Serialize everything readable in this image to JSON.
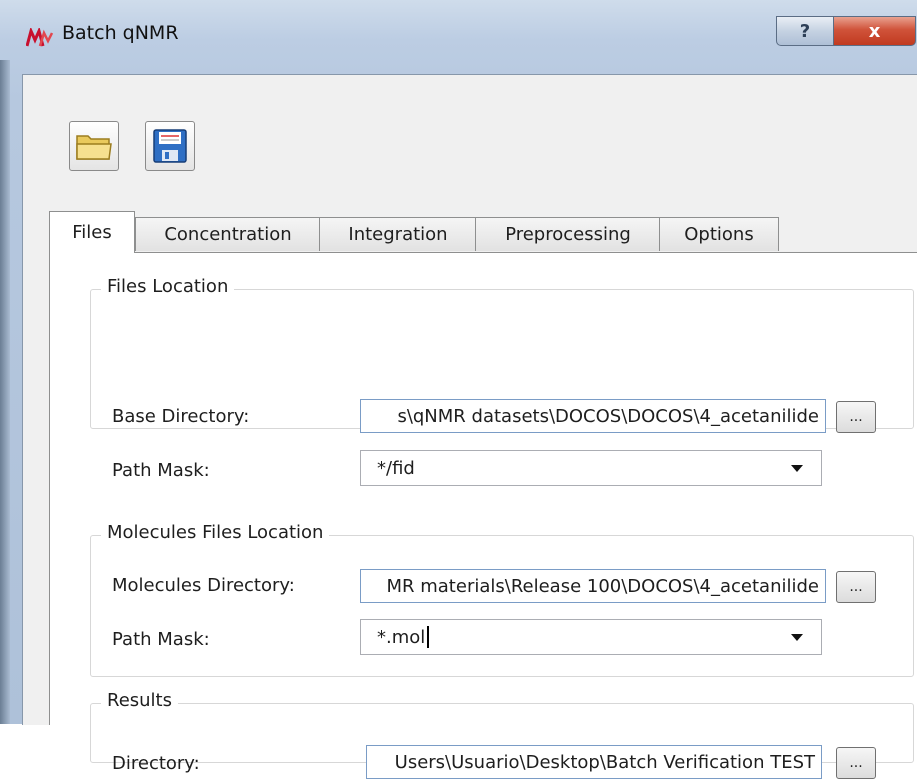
{
  "window": {
    "title": "Batch qNMR",
    "help_glyph": "?",
    "close_glyph": "x"
  },
  "toolbar": {
    "open_icon": "folder-open-icon",
    "save_icon": "floppy-save-icon"
  },
  "tabs": [
    {
      "label": "Files",
      "active": true
    },
    {
      "label": "Concentration",
      "active": false
    },
    {
      "label": "Integration",
      "active": false
    },
    {
      "label": "Preprocessing",
      "active": false
    },
    {
      "label": "Options",
      "active": false
    }
  ],
  "files_location": {
    "title": "Files Location",
    "base_directory_label": "Base Directory:",
    "base_directory_value": "s\\qNMR datasets\\DOCOS\\DOCOS\\4_acetanilide",
    "path_mask_label": "Path Mask:",
    "path_mask_value": "*/fid",
    "browse_label": "..."
  },
  "molecules_location": {
    "title": "Molecules Files Location",
    "molecules_directory_label": "Molecules Directory:",
    "molecules_directory_value": "MR materials\\Release 100\\DOCOS\\4_acetanilide",
    "path_mask_label": "Path Mask:",
    "path_mask_value": "*.mol",
    "browse_label": "..."
  },
  "results": {
    "title": "Results",
    "directory_label": "Directory:",
    "directory_value": "Users\\Usuario\\Desktop\\Batch Verification TEST",
    "browse_label": "..."
  },
  "colors": {
    "accent_border": "#7a9cc6",
    "close_red": "#c13a20"
  }
}
